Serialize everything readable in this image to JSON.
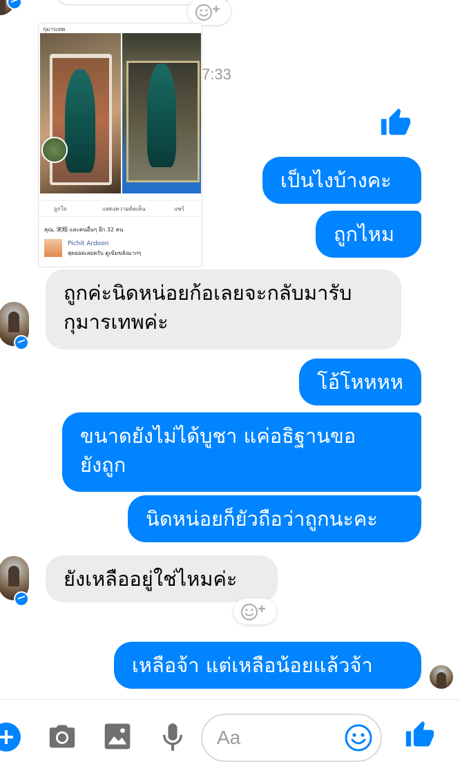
{
  "timestamp_text": "7:33",
  "shared_post": {
    "header_text": "กุมารเทพ",
    "actions": [
      "ถูกใจ",
      "แสดงความคิดเห็น",
      "แชร์"
    ],
    "reactions_text": "คุณ, 宋翔 และคนอื่นๆ อีก 32 คน",
    "comment_author": "Pichit Ardoon",
    "comment_text": "สุดยอดเลยครับ ดูเข้มขลังมากๆ"
  },
  "messages": [
    {
      "side": "me",
      "kind": "like"
    },
    {
      "side": "me",
      "text": "เป็นไงบ้างคะ"
    },
    {
      "side": "me",
      "text": "ถูกไหม"
    },
    {
      "side": "them",
      "lines": [
        "ถูกค่ะนิดหน่อยก้อเลยจะกลับมารับ",
        "กุมารเทพค่ะ"
      ]
    },
    {
      "side": "me",
      "text": "โอ้โหหหห"
    },
    {
      "side": "me",
      "lines": [
        "ขนาดยังไม่ได้บูชา แค่อธิฐานขอ",
        "ยังถูก"
      ]
    },
    {
      "side": "me",
      "text": "นิดหน่อยก็ยัวถือว่าถูกนะคะ"
    },
    {
      "side": "them",
      "text": "ยังเหลืออยู่ใช่ไหมค่ะ"
    },
    {
      "side": "me",
      "text": "เหลือจ้า  แต่เหลือน้อยแล้วจ้า"
    }
  ],
  "composer": {
    "placeholder": "Aa",
    "icons": [
      "plus-icon",
      "camera-icon",
      "image-icon",
      "microphone-icon",
      "emoji-icon",
      "like-icon"
    ]
  },
  "colors": {
    "accent": "#0084ff",
    "incoming_bubble": "#ececec",
    "outgoing_text": "#ffffff"
  }
}
